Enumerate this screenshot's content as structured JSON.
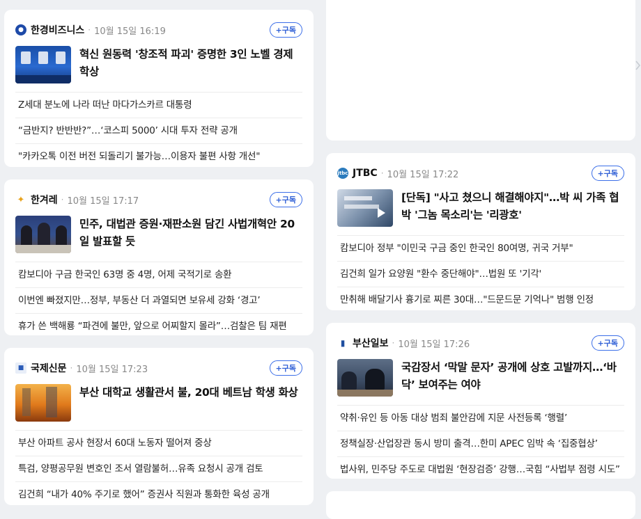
{
  "cards": [
    {
      "press": "한경비즈니스",
      "time": "10월 15일 16:19",
      "subscribe": "+구독",
      "headline": "혁신 원동력 '창조적 파괴' 증명한 3인 노벨 경제학상",
      "items": [
        "Z세대 분노에 나라 떠난 마다가스카르 대통령",
        "“금반지? 반반반?”…‘코스피 5000’ 시대 투자 전략 공개",
        "\"카카오톡 이전 버전 되돌리기 불가능…이용자 불편 사항 개선\""
      ]
    },
    {
      "press": "한겨레",
      "time": "10월 15일 17:17",
      "subscribe": "+구독",
      "headline": "민주, 대법관 증원·재판소원 담긴 사법개혁안 20일 발표할 듯",
      "items": [
        "캄보디아 구금 한국인 63명 중 4명, 어제 국적기로 송환",
        "이번엔 빠졌지만…정부, 부동산 더 과열되면 보유세 강화 ‘경고’",
        "휴가 쓴 백해룡 “파견에 불만, 앞으로 어찌할지 몰라”…검찰은 팀 재편"
      ]
    },
    {
      "press": "국제신문",
      "time": "10월 15일 17:23",
      "subscribe": "+구독",
      "headline": "부산 대학교 생활관서 불, 20대 베트남 학생 화상",
      "items": [
        "부산 아파트 공사 현장서 60대 노동자 떨어져 중상",
        "특검, 양평공무원 변호인 조서 열람불허…유족 요청시 공개 검토",
        "김건희 “내가 40% 주기로 했어” 증권사 직원과 통화한 육성 공개"
      ]
    },
    {
      "press": "JTBC",
      "time": "10월 15일 17:22",
      "subscribe": "+구독",
      "headline": "[단독] \"사고 쳤으니 해결해야지\"…박 씨 가족 협박 '그놈 목소리'는 '리광호'",
      "items": [
        "캄보디아 정부 \"이민국 구금 중인 한국인 80여명, 귀국 거부\"",
        "김건희 일가 요양원 \"환수 중단해야\"…법원 또 '기각'",
        "만취해 배달기사 흉기로 찌른 30대…\"드문드문 기억나\" 범행 인정"
      ]
    },
    {
      "press": "부산일보",
      "time": "10월 15일 17:26",
      "subscribe": "+구독",
      "headline": "국감장서 ‘막말 문자’ 공개에 상호 고발까지…‘바닥’ 보여주는 여야",
      "items": [
        "약취·유인 등 아동 대상 범죄 불안감에 지문 사전등록 ‘행렬’",
        "정책실장·산업장관 동시 방미 출격…한미 APEC 임박 속 ‘집중협상’",
        "법사위, 민주당 주도로 대법원 ‘현장검증’ 강행…국힘 “사법부 점령 시도”"
      ]
    }
  ],
  "colors": {
    "accent": "#3b6ee8",
    "background": "#eef0f3"
  },
  "icons": [
    "chevron-right-icon",
    "play-icon"
  ]
}
